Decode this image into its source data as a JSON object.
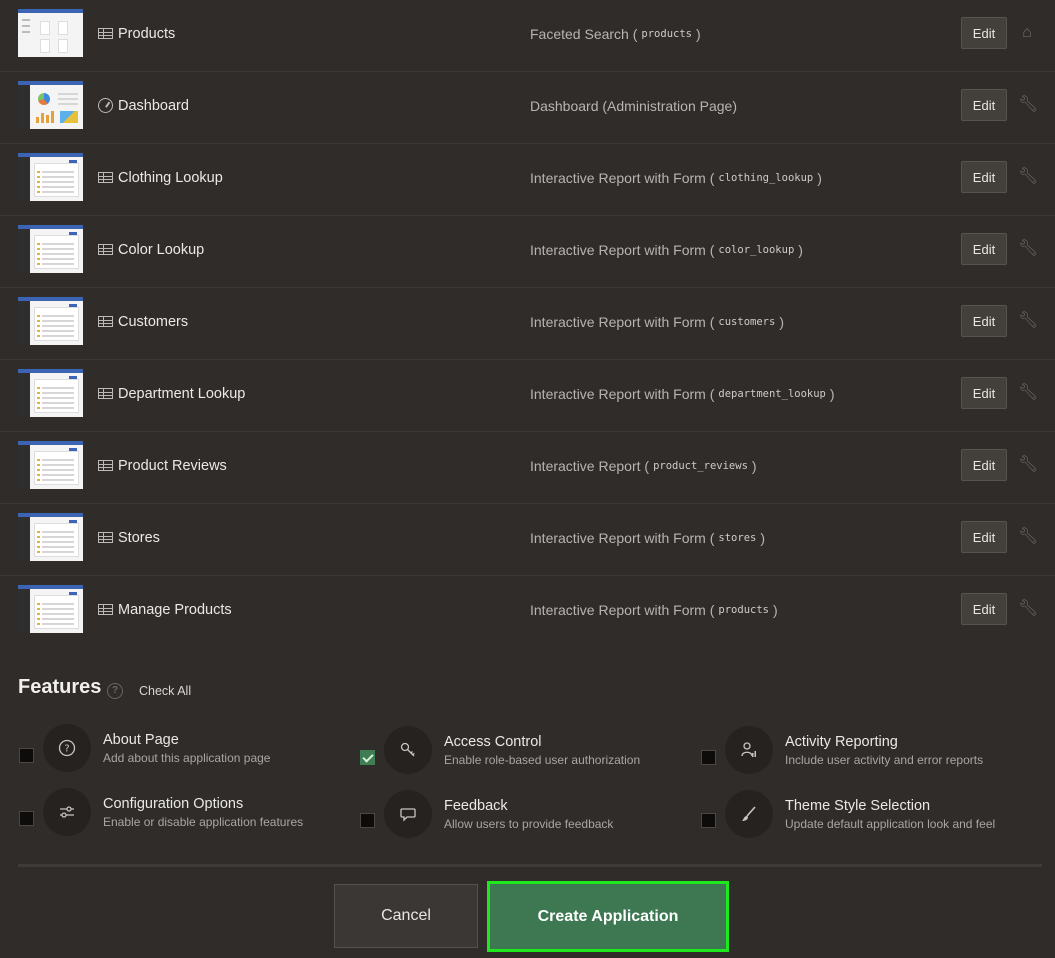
{
  "pages": [
    {
      "name": "Products",
      "type": "Faceted Search",
      "source": "products",
      "icon": "grid-icon",
      "row_icon": "home-icon"
    },
    {
      "name": "Dashboard",
      "type": "Dashboard (Administration Page)",
      "source": "",
      "icon": "gauge-icon",
      "row_icon": "wrench-icon"
    },
    {
      "name": "Clothing Lookup",
      "type": "Interactive Report with Form",
      "source": "clothing_lookup",
      "icon": "grid-icon",
      "row_icon": "wrench-icon"
    },
    {
      "name": "Color Lookup",
      "type": "Interactive Report with Form",
      "source": "color_lookup",
      "icon": "grid-icon",
      "row_icon": "wrench-icon"
    },
    {
      "name": "Customers",
      "type": "Interactive Report with Form",
      "source": "customers",
      "icon": "grid-icon",
      "row_icon": "wrench-icon"
    },
    {
      "name": "Department Lookup",
      "type": "Interactive Report with Form",
      "source": "department_lookup",
      "icon": "grid-icon",
      "row_icon": "wrench-icon"
    },
    {
      "name": "Product Reviews",
      "type": "Interactive Report",
      "source": "product_reviews",
      "icon": "grid-icon",
      "row_icon": "wrench-icon"
    },
    {
      "name": "Stores",
      "type": "Interactive Report with Form",
      "source": "stores",
      "icon": "grid-icon",
      "row_icon": "wrench-icon"
    },
    {
      "name": "Manage Products",
      "type": "Interactive Report with Form",
      "source": "products",
      "icon": "grid-icon",
      "row_icon": "wrench-icon"
    }
  ],
  "edit_label": "Edit",
  "features": {
    "title": "Features",
    "check_all": "Check All",
    "items": [
      {
        "title": "About Page",
        "desc": "Add about this application page",
        "checked": false,
        "icon": "question-circle-icon"
      },
      {
        "title": "Access Control",
        "desc": "Enable role-based user authorization",
        "checked": true,
        "icon": "key-icon"
      },
      {
        "title": "Activity Reporting",
        "desc": "Include user activity and error reports",
        "checked": false,
        "icon": "user-chart-icon"
      },
      {
        "title": "Configuration Options",
        "desc": "Enable or disable application features",
        "checked": false,
        "icon": "sliders-icon"
      },
      {
        "title": "Feedback",
        "desc": "Allow users to provide feedback",
        "checked": false,
        "icon": "speech-bubble-icon"
      },
      {
        "title": "Theme Style Selection",
        "desc": "Update default application look and feel",
        "checked": false,
        "icon": "brush-icon"
      }
    ]
  },
  "buttons": {
    "cancel": "Cancel",
    "create": "Create Application"
  },
  "colors": {
    "background": "#2f2c29",
    "create_button": "#3d7852",
    "create_button_highlight": "#1ee81e",
    "checkbox_checked": "#3f7d52"
  }
}
